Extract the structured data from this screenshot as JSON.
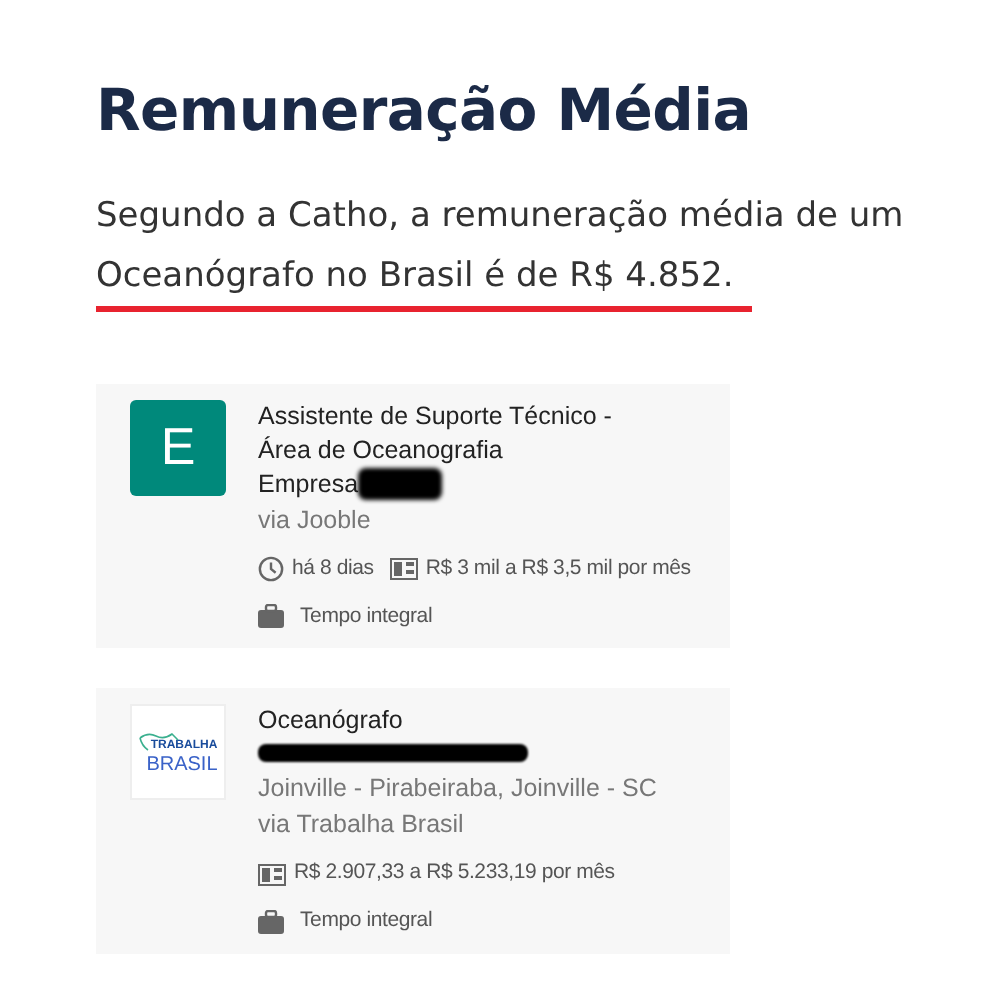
{
  "heading": "Remuneração Média",
  "intro": {
    "text": "Segundo a Catho, a remuneração média de um Oceanógrafo no Brasil é de R$ 4.852.",
    "underlined": true
  },
  "jobs": [
    {
      "logo": {
        "kind": "letter",
        "letter": "E",
        "color": "#00897b"
      },
      "title": "Assistente de Suporte Técnico - Área de Oceanografia",
      "company": "Empresa",
      "company_redacted": true,
      "via": "via Jooble",
      "posted": "há 8 dias",
      "salary": "R$ 3 mil a R$ 3,5 mil por mês",
      "schedule": "Tempo integral"
    },
    {
      "logo": {
        "kind": "brand",
        "top": "TRABALHA",
        "bottom": "BRASIL"
      },
      "title": "Oceanógrafo",
      "company_redacted": true,
      "location": "Joinville - Pirabeiraba, Joinville - SC",
      "via": "via Trabalha Brasil",
      "salary": "R$ 2.907,33 a R$ 5.233,19 por mês",
      "schedule": "Tempo integral"
    }
  ]
}
